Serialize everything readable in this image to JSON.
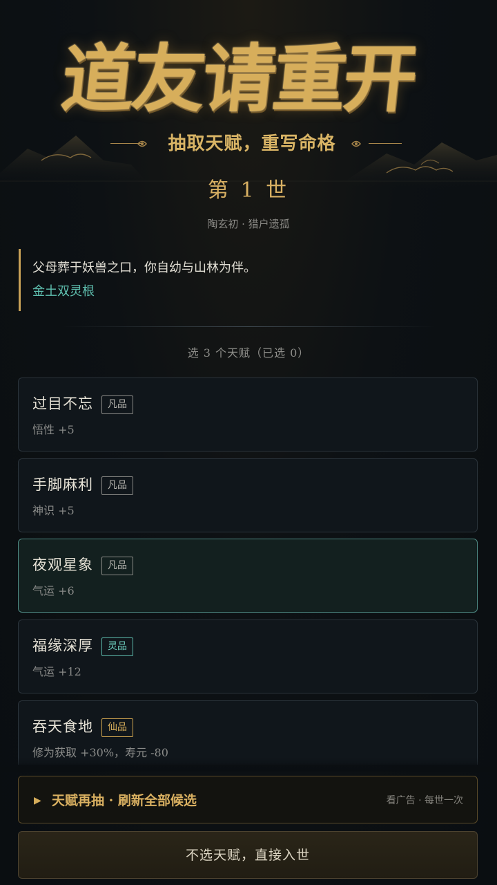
{
  "banner": {
    "title": "道友请重开",
    "subtitle": "抽取天赋，重写命格"
  },
  "life": {
    "title": "第 1 世",
    "identity": "陶玄初 · 猎户遗孤"
  },
  "story": {
    "text": "父母葬于妖兽之口，你自幼与山林为伴。",
    "spirit_root": "金土双灵根"
  },
  "selection": {
    "hint": "选 3 个天赋（已选 0）"
  },
  "talents": [
    {
      "name": "过目不忘",
      "grade": "凡品",
      "effect": "悟性 +5"
    },
    {
      "name": "手脚麻利",
      "grade": "凡品",
      "effect": "神识 +5"
    },
    {
      "name": "夜观星象",
      "grade": "凡品",
      "effect": "气运 +6"
    },
    {
      "name": "福缘深厚",
      "grade": "灵品",
      "effect": "气运 +12"
    },
    {
      "name": "吞天食地",
      "grade": "仙品",
      "effect": "修为获取 +30%，寿元 -80"
    }
  ],
  "reroll": {
    "label": "天赋再抽 · 刷新全部候选",
    "note": "看广告 · 每世一次"
  },
  "skip_button": "不选天赋，直接入世",
  "colors": {
    "gold": "#d7ae5b",
    "jade": "#5fc0b0",
    "background": "#0b0f13"
  }
}
